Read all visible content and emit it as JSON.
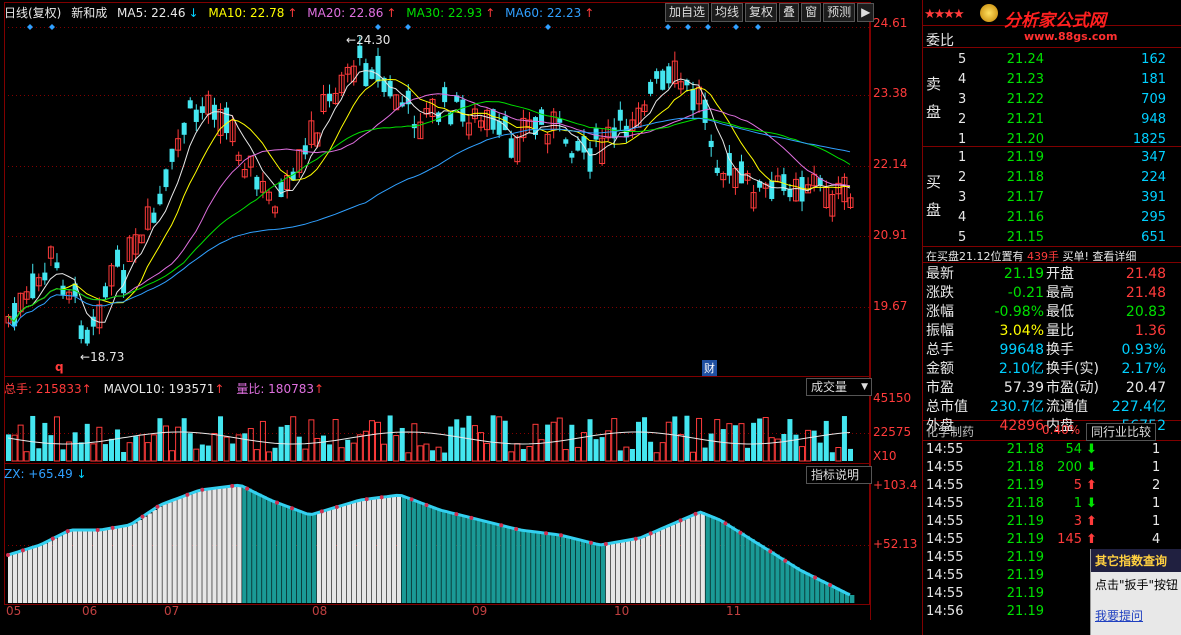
{
  "header": {
    "period_label": "日线(复权)",
    "stock_name": "新和成",
    "ma": [
      {
        "label": "MA5: 22.46",
        "arrow": "↓",
        "color": "#e8e8e8"
      },
      {
        "label": "MA10: 22.78",
        "arrow": "↑",
        "color": "#ffff00"
      },
      {
        "label": "MA20: 22.86",
        "arrow": "↑",
        "color": "#e070e0"
      },
      {
        "label": "MA30: 22.93",
        "arrow": "↑",
        "color": "#00e000"
      },
      {
        "label": "MA60: 22.23",
        "arrow": "↑",
        "color": "#30a0ff"
      }
    ]
  },
  "toolbar": {
    "add_self": "加自选",
    "ma": "均线",
    "restore": "复权",
    "overlay": "叠",
    "window": "窗",
    "predict": "预测",
    "more": "▶"
  },
  "brand": {
    "stars": "★★★★",
    "logo_text": "分析家公式网",
    "logo_url": "www.88gs.com"
  },
  "price_axis": [
    "24.61",
    "23.38",
    "22.14",
    "20.91",
    "19.67"
  ],
  "annotations": {
    "high": "24.30",
    "low": "18.73",
    "marker_q": "q",
    "marker_cai": "财"
  },
  "volume": {
    "total_label": "总手: 215833",
    "total_arrow": "↑",
    "mavol_label": "MAVOL10: 193571",
    "mavol_arrow": "↑",
    "ratio_label": "量比: 180783",
    "ratio_arrow": "↑",
    "dropdown": "成交量",
    "axis": [
      "45150",
      "22575",
      "X10"
    ]
  },
  "indicator": {
    "label": "ZX: +65.49",
    "arrow": "↓",
    "help": "指标说明",
    "axis": [
      "+103.4",
      "+52.13"
    ]
  },
  "x_axis": [
    "05",
    "06",
    "07",
    "08",
    "09",
    "10",
    "11"
  ],
  "order_book": {
    "title": "委比",
    "sell_label": "卖盘",
    "buy_label": "买盘",
    "sell": [
      {
        "lvl": "5",
        "price": "21.24",
        "vol": "162"
      },
      {
        "lvl": "4",
        "price": "21.23",
        "vol": "181"
      },
      {
        "lvl": "3",
        "price": "21.22",
        "vol": "709"
      },
      {
        "lvl": "2",
        "price": "21.21",
        "vol": "948"
      },
      {
        "lvl": "1",
        "price": "21.20",
        "vol": "1825"
      }
    ],
    "buy": [
      {
        "lvl": "1",
        "price": "21.19",
        "vol": "347"
      },
      {
        "lvl": "2",
        "price": "21.18",
        "vol": "224"
      },
      {
        "lvl": "3",
        "price": "21.17",
        "vol": "391"
      },
      {
        "lvl": "4",
        "price": "21.16",
        "vol": "295"
      },
      {
        "lvl": "5",
        "price": "21.15",
        "vol": "651"
      }
    ],
    "notice_a": "在买盘21.12位置有",
    "notice_b": "439手",
    "notice_c": "买单!",
    "notice_link": "查看详细"
  },
  "quote": [
    {
      "l1": "最新",
      "v1": "21.19",
      "c1": "green",
      "l2": "开盘",
      "v2": "21.48",
      "c2": "red"
    },
    {
      "l1": "涨跌",
      "v1": "-0.21",
      "c1": "green",
      "l2": "最高",
      "v2": "21.48",
      "c2": "red"
    },
    {
      "l1": "涨幅",
      "v1": "-0.98%",
      "c1": "green",
      "l2": "最低",
      "v2": "20.83",
      "c2": "green"
    },
    {
      "l1": "振幅",
      "v1": "3.04%",
      "c1": "yellow",
      "l2": "量比",
      "v2": "1.36",
      "c2": "red"
    },
    {
      "l1": "总手",
      "v1": "99648",
      "c1": "cyan",
      "l2": "换手",
      "v2": "0.93%",
      "c2": "cyan"
    },
    {
      "l1": "金额",
      "v1": "2.10亿",
      "c1": "cyan",
      "l2": "换手(实)",
      "v2": "2.17%",
      "c2": "cyan"
    },
    {
      "l1": "市盈",
      "v1": "57.39",
      "c1": "white",
      "l2": "市盈(动)",
      "v2": "20.47",
      "c2": "white"
    },
    {
      "l1": "总市值",
      "v1": "230.7亿",
      "c1": "cyan",
      "l2": "流通值",
      "v2": "227.4亿",
      "c2": "cyan"
    },
    {
      "l1": "外盘",
      "v1": "42896",
      "c1": "red",
      "l2": "内盘",
      "v2": "56752",
      "c2": "cyan"
    }
  ],
  "sector": {
    "name": "化学制药",
    "pct": "0.40%",
    "compare": "同行业比较"
  },
  "ticks": [
    {
      "time": "14:55",
      "price": "21.18",
      "pc": "green",
      "vol": "54",
      "dir": "down",
      "n": "1"
    },
    {
      "time": "14:55",
      "price": "21.18",
      "pc": "green",
      "vol": "200",
      "dir": "down",
      "n": "1"
    },
    {
      "time": "14:55",
      "price": "21.19",
      "pc": "green",
      "vol": "5",
      "dir": "up",
      "n": "2"
    },
    {
      "time": "14:55",
      "price": "21.18",
      "pc": "green",
      "vol": "1",
      "dir": "down",
      "n": "1"
    },
    {
      "time": "14:55",
      "price": "21.19",
      "pc": "green",
      "vol": "3",
      "dir": "up",
      "n": "1"
    },
    {
      "time": "14:55",
      "price": "21.19",
      "pc": "green",
      "vol": "145",
      "dir": "up",
      "n": "4"
    },
    {
      "time": "14:55",
      "price": "21.19",
      "pc": "green",
      "vol": "",
      "dir": "",
      "n": ""
    },
    {
      "time": "14:55",
      "price": "21.19",
      "pc": "green",
      "vol": "",
      "dir": "",
      "n": ""
    },
    {
      "time": "14:55",
      "price": "21.19",
      "pc": "green",
      "vol": "",
      "dir": "",
      "n": ""
    },
    {
      "time": "14:56",
      "price": "21.19",
      "pc": "green",
      "vol": "",
      "dir": "",
      "n": ""
    }
  ],
  "popup": {
    "title": "其它指数查询",
    "text": "点击\"扳手\"按钮",
    "link": "我要提问"
  },
  "colors": {
    "up": "#ff3b3b",
    "down": "#44e6f0",
    "grid": "#800000",
    "ma5": "#e8e8e8",
    "ma10": "#ffff00",
    "ma20": "#e070e0",
    "ma30": "#00e000",
    "ma60": "#30a0ff",
    "zx_white": "#e6e6e6",
    "zx_teal": "#1a9a96"
  }
}
